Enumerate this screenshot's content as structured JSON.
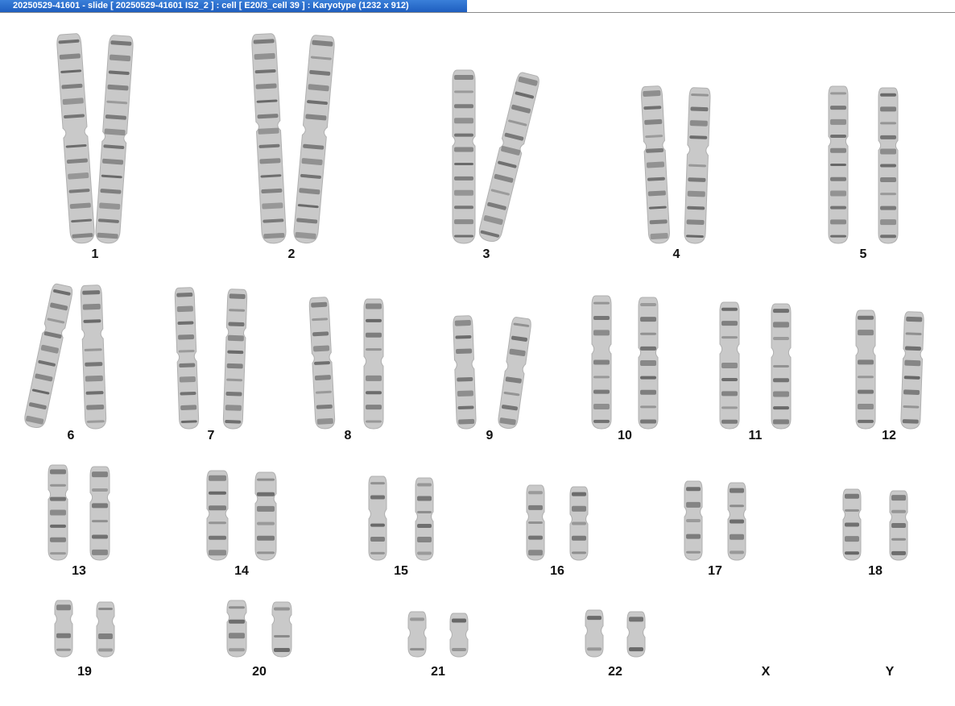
{
  "window": {
    "title": "20250529-41601 - slide [ 20250529-41601 IS2_2 ] : cell [ E20/3_cell 39 ] : Karyotype  (1232 x 912)"
  },
  "karyotype": {
    "chromosomes": [
      {
        "label": "1"
      },
      {
        "label": "2"
      },
      {
        "label": "3"
      },
      {
        "label": "4"
      },
      {
        "label": "5"
      },
      {
        "label": "6"
      },
      {
        "label": "7"
      },
      {
        "label": "8"
      },
      {
        "label": "9"
      },
      {
        "label": "10"
      },
      {
        "label": "11"
      },
      {
        "label": "12"
      },
      {
        "label": "13"
      },
      {
        "label": "14"
      },
      {
        "label": "15"
      },
      {
        "label": "16"
      },
      {
        "label": "17"
      },
      {
        "label": "18"
      },
      {
        "label": "19"
      },
      {
        "label": "20"
      },
      {
        "label": "21"
      },
      {
        "label": "22"
      },
      {
        "label": "X"
      },
      {
        "label": "Y"
      }
    ]
  }
}
